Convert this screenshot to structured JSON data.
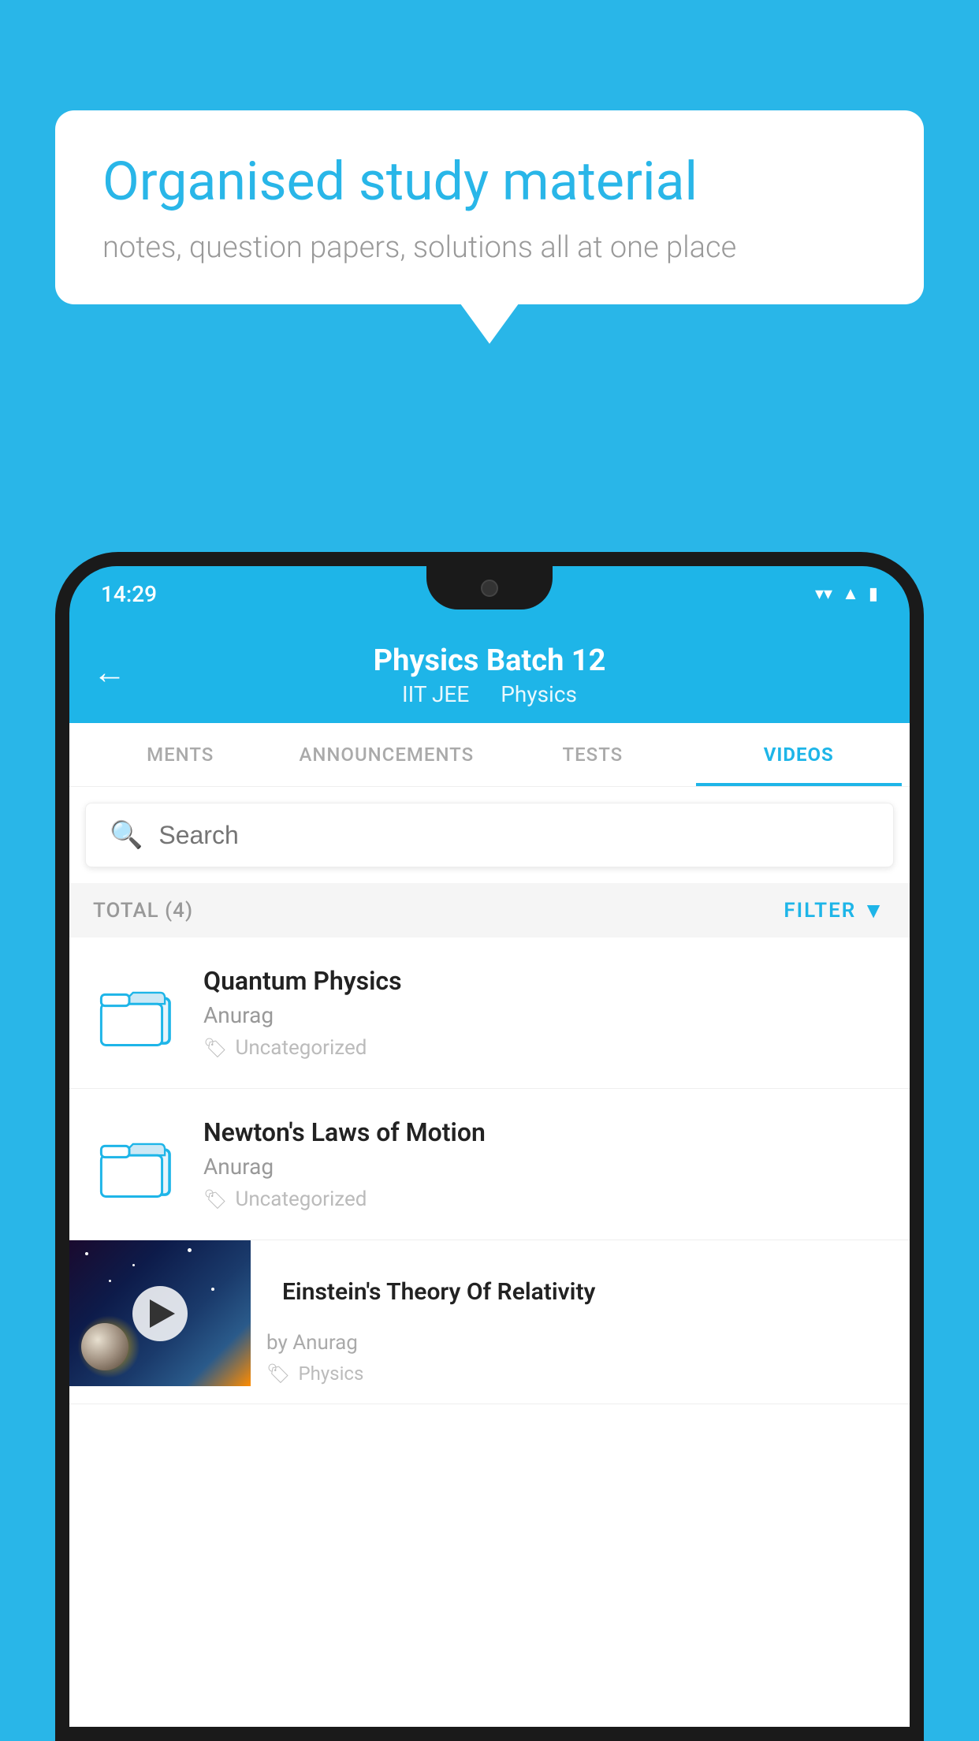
{
  "background_color": "#29b6e8",
  "speech_bubble": {
    "title": "Organised study material",
    "subtitle": "notes, question papers, solutions all at one place"
  },
  "phone": {
    "status_bar": {
      "time": "14:29",
      "icons": [
        "wifi",
        "signal",
        "battery"
      ]
    },
    "header": {
      "back_label": "←",
      "title": "Physics Batch 12",
      "tag1": "IIT JEE",
      "tag2": "Physics"
    },
    "tabs": [
      {
        "label": "MENTS",
        "active": false
      },
      {
        "label": "ANNOUNCEMENTS",
        "active": false
      },
      {
        "label": "TESTS",
        "active": false
      },
      {
        "label": "VIDEOS",
        "active": true
      }
    ],
    "search": {
      "placeholder": "Search"
    },
    "total_bar": {
      "total_label": "TOTAL (4)",
      "filter_label": "FILTER"
    },
    "videos": [
      {
        "id": 1,
        "title": "Quantum Physics",
        "author": "Anurag",
        "tag": "Uncategorized",
        "type": "folder"
      },
      {
        "id": 2,
        "title": "Newton's Laws of Motion",
        "author": "Anurag",
        "tag": "Uncategorized",
        "type": "folder"
      },
      {
        "id": 3,
        "title": "Einstein's Theory Of Relativity",
        "author": "by Anurag",
        "tag": "Physics",
        "type": "video"
      }
    ]
  }
}
